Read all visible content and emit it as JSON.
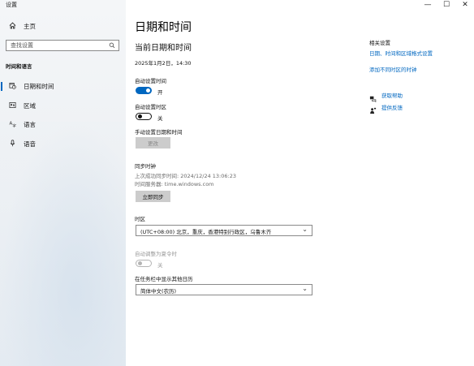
{
  "window": {
    "title": "设置",
    "minimize": "—",
    "maximize": "☐",
    "close": "✕"
  },
  "sidebar": {
    "home_label": "主页",
    "home_icon": "home-icon",
    "search_placeholder": "查找设置",
    "search_icon": "search-icon",
    "group_label": "时间和语言",
    "items": [
      {
        "label": "日期和时间",
        "icon": "calendar-clock-icon",
        "active": true
      },
      {
        "label": "区域",
        "icon": "globe-icon",
        "active": false
      },
      {
        "label": "语言",
        "icon": "language-icon",
        "active": false
      },
      {
        "label": "语音",
        "icon": "microphone-icon",
        "active": false
      }
    ]
  },
  "main": {
    "title": "日期和时间",
    "current_heading": "当前日期和时间",
    "current_datetime": "2025年1月2日，14:30",
    "auto_time": {
      "label": "自动设置时间",
      "state": "开",
      "on": true
    },
    "auto_timezone": {
      "label": "自动设置时区",
      "state": "关",
      "on": false
    },
    "manual": {
      "label": "手动设置日期和时间",
      "button": "更改"
    },
    "sync": {
      "heading": "同步时钟",
      "last_sync": "上次成功同步时间: 2024/12/24 13:06:23",
      "server": "时间服务器: time.windows.com",
      "button": "立即同步"
    },
    "timezone": {
      "label": "时区",
      "value": "(UTC+08:00) 北京，重庆，香港特别行政区，乌鲁木齐"
    },
    "dst": {
      "label": "自动调整为夏令时",
      "state": "关",
      "on": false
    },
    "calendar": {
      "label": "在任务栏中显示其他日历",
      "value": "简体中文(农历)"
    }
  },
  "related": {
    "heading": "相关设置",
    "links": [
      "日期、时间和区域格式设置",
      "添加不同时区的时钟"
    ],
    "help": [
      {
        "label": "获取帮助",
        "icon": "chat-help-icon"
      },
      {
        "label": "提供反馈",
        "icon": "feedback-person-icon"
      }
    ]
  },
  "colors": {
    "accent": "#0067c0",
    "sidebar_bg": "#f1f3f6",
    "disabled_button_bg": "#cccccc"
  }
}
